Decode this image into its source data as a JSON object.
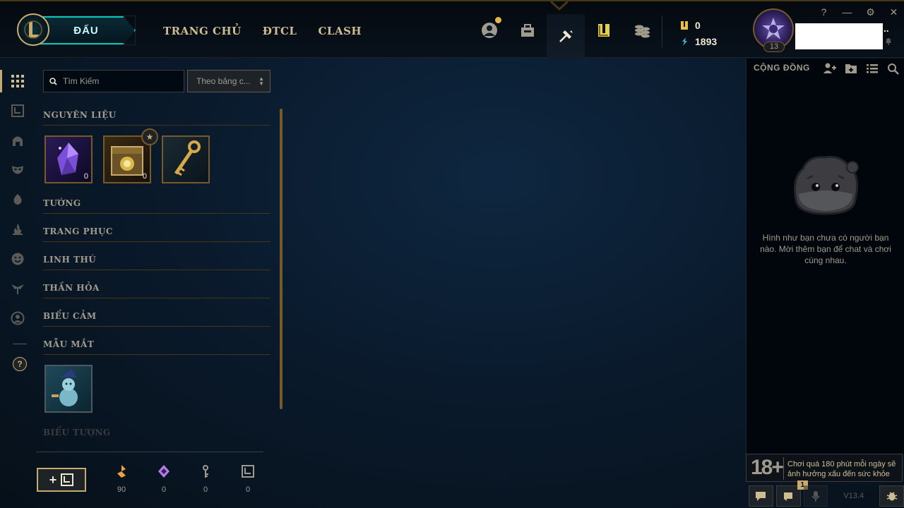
{
  "header": {
    "play_label": "ĐẤU",
    "nav": [
      "TRANG CHỦ",
      "ĐTCL",
      "CLASH"
    ],
    "currency": {
      "rp": "0",
      "be": "1893"
    },
    "level": "13",
    "name_suffix": "...",
    "window_controls": [
      "?",
      "—",
      "⚙",
      "✕"
    ]
  },
  "collection": {
    "search_placeholder": "Tìm Kiếm",
    "sort_label": "Theo bảng c...",
    "categories": [
      "NGUYÊN LIỆU",
      "TƯỚNG",
      "TRANG PHỤC",
      "LINH THÚ",
      "THẦN HỎA",
      "BIỂU CẢM",
      "MẪU MẮT",
      "BIỂU TƯỢNG"
    ],
    "materials": [
      {
        "name": "key-fragment-orb",
        "count": "0"
      },
      {
        "name": "hextech-chest",
        "count": "0"
      },
      {
        "name": "hextech-key",
        "count": ""
      }
    ],
    "craft_plus": "+",
    "resources": [
      {
        "icon": "orange-essence-icon",
        "value": "90",
        "color": "#f0a040"
      },
      {
        "icon": "mythic-essence-icon",
        "value": "0",
        "color": "#b57ce8"
      },
      {
        "icon": "key-fragment-icon",
        "value": "0",
        "color": "#a09b8c"
      },
      {
        "icon": "chest-resource-icon",
        "value": "0",
        "color": "#a09b8c"
      }
    ]
  },
  "social": {
    "title": "CỘNG ĐỒNG",
    "empty_message": "Hình như bạn chưa có người bạn nào. Mời thêm bạn để chat và chơi cùng nhau.",
    "age_badge": "18+",
    "age_warning": "Chơi quá 180 phút mỗi ngày sẽ ảnh hưởng xấu đến sức khỏe",
    "notif_count": "1",
    "version": "V13.4"
  },
  "colors": {
    "gold": "#c8aa6e",
    "teal": "#0ac8b9",
    "bg": "#0a1a2c"
  }
}
